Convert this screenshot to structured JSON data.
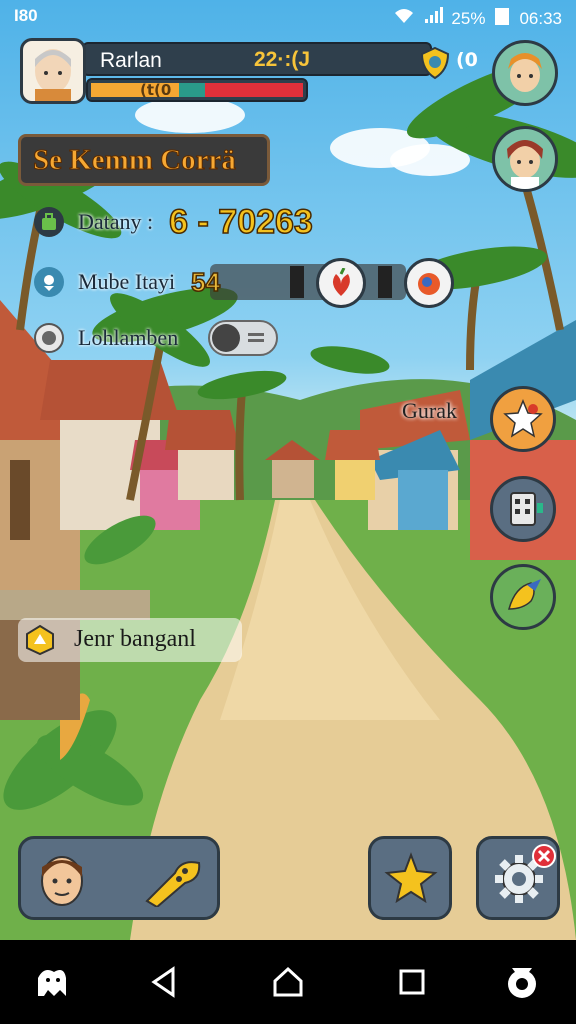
{
  "status_bar": {
    "left": "I80",
    "battery": "25%",
    "time": "06:33"
  },
  "player": {
    "name": "Rarlan",
    "score": "22·:(J",
    "bar_text": "(t(0",
    "shield_value": "(0"
  },
  "banner": {
    "title": "Se Kemm Corrä"
  },
  "stats": [
    {
      "label": "Datany :",
      "value": "6 - 70263"
    },
    {
      "label": "Mube Itayi",
      "value": "54"
    },
    {
      "label": "Lohlamben"
    }
  ],
  "side_label": "Gurak",
  "quest": {
    "label": "Jenr banganl"
  },
  "colors": {
    "gold": "#f4c21e",
    "bar_orange": "#f6a833",
    "bar_teal": "#2a9a8a",
    "bar_red": "#e0303a"
  },
  "icons": [
    "avatar",
    "shield-icon",
    "fox-avatar",
    "girl-avatar",
    "bag-icon",
    "pin-icon",
    "coin-icon",
    "fruit-icon",
    "meat-icon",
    "fox-star-icon",
    "tablet-icon",
    "bird-icon",
    "quest-icon",
    "character-icon",
    "flute-icon",
    "star-fox-icon",
    "gear-icon",
    "badge-x-icon",
    "back-icon",
    "home-icon",
    "recents-icon"
  ]
}
